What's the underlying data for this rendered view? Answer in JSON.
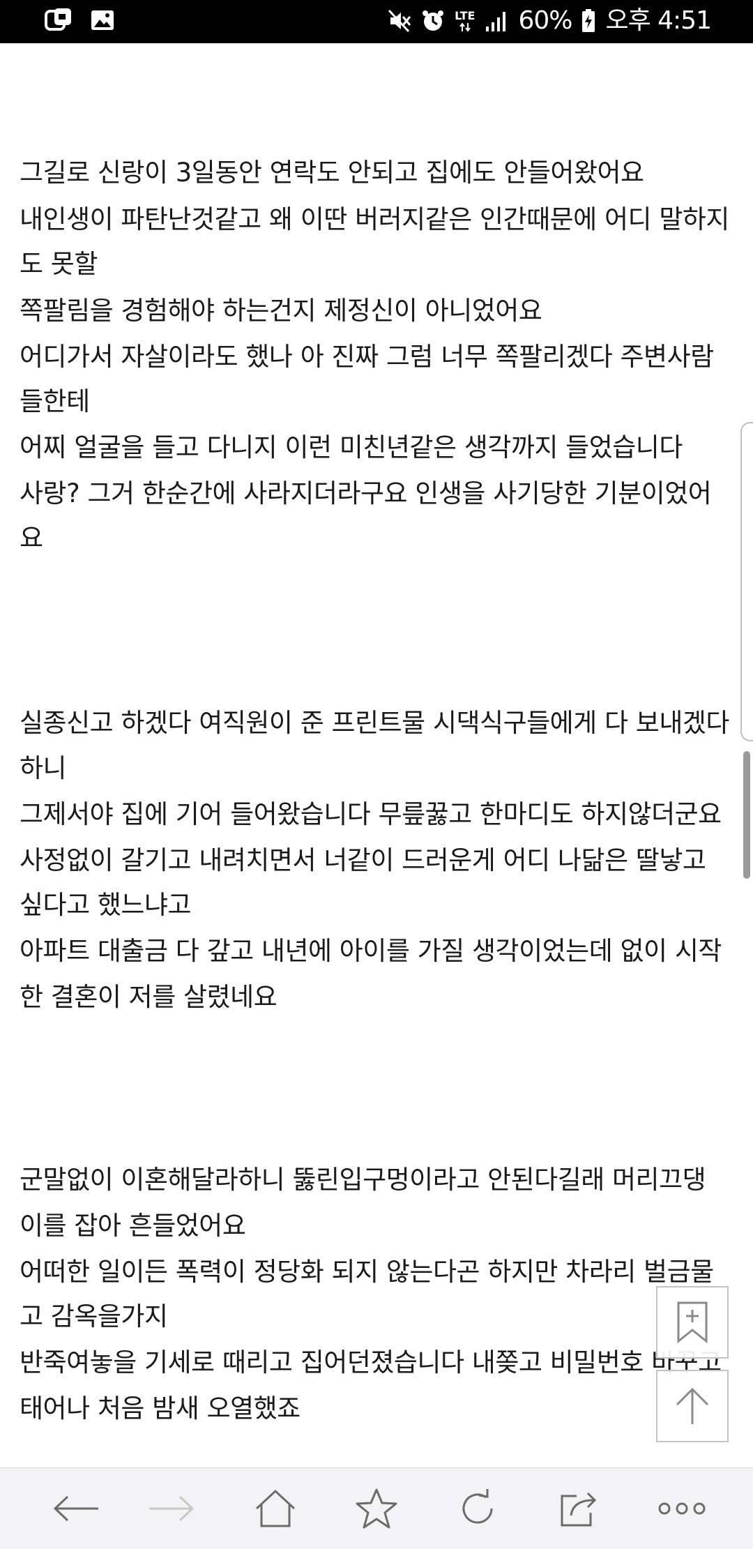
{
  "status_bar": {
    "battery": "60%",
    "time": "오후 4:51",
    "network": "LTE"
  },
  "article": {
    "lines": [
      "그길로 신랑이 3일동안 연락도 안되고 집에도 안들어왔어요",
      "내인생이 파탄난것같고 왜 이딴 버러지같은 인간때문에 어디 말하지",
      "도 못할",
      "쪽팔림을 경험해야 하는건지 제정신이 아니었어요",
      "어디가서 자살이라도 했나 아 진짜 그럼 너무 쪽팔리겠다 주변사람",
      "들한테",
      "어찌 얼굴을 들고 다니지 이런 미친년같은 생각까지 들었습니다",
      "사랑? 그거 한순간에 사라지더라구요 인생을 사기당한 기분이었어",
      "요",
      "실종신고 하겠다 여직원이 준 프린트물 시댁식구들에게 다 보내겠다",
      "하니",
      "그제서야 집에 기어 들어왔습니다 무릎꿇고 한마디도 하지않더군요",
      "사정없이 갈기고 내려치면서 너같이 드러운게 어디 나닮은 딸낳고",
      "싶다고 했느냐고",
      "아파트 대출금 다 갚고 내년에 아이를 가질 생각이었는데 없이 시작",
      "한 결혼이 저를 살렸네요",
      "군말없이 이혼해달라하니 뚫린입구멍이라고 안된다길래 머리끄댕",
      "이를 잡아 흔들었어요",
      "어떠한 일이든 폭력이 정당화 되지 않는다곤 하지만 차라리 벌금물",
      "고 감옥을가지",
      "반죽여놓을 기세로 때리고 집어던졌습니다 내쫒고 비밀번호 바꾸고",
      "태어나 처음 밤새 오열했죠"
    ]
  },
  "floating": {
    "bookmark_icon": "bookmark-add-icon",
    "top_icon": "arrow-up-icon"
  },
  "toolbar": {
    "icons": [
      "back-arrow-icon",
      "forward-arrow-icon",
      "home-icon",
      "star-icon",
      "refresh-icon",
      "share-icon",
      "more-icon"
    ],
    "colors": {
      "active": "#6b6b6b",
      "disabled": "#c8c8c8"
    }
  }
}
